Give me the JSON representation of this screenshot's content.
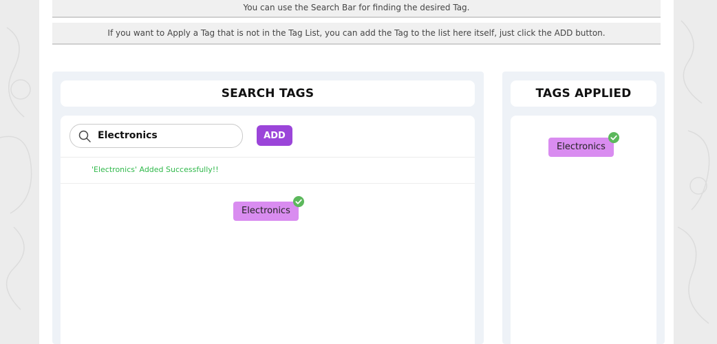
{
  "info": {
    "line1": "You can use the Search Bar for finding the desired Tag.",
    "line2": "If you want to Apply a Tag that is not in the Tag List, you can add the Tag to the list here itself, just click the ADD button."
  },
  "search_panel": {
    "title": "SEARCH TAGS",
    "search_value": "Electronics",
    "search_icon": "search-icon",
    "add_label": "ADD",
    "success_message": "'Electronics' Added Successfully!!",
    "tags": [
      {
        "label": "Electronics",
        "selected": true
      }
    ]
  },
  "applied_panel": {
    "title": "TAGS APPLIED",
    "tags": [
      {
        "label": "Electronics",
        "selected": true
      }
    ]
  },
  "colors": {
    "accent": "#9b45d9",
    "tag_bg": "#d98cf0",
    "success": "#2fb84a",
    "check": "#5cb85c"
  }
}
